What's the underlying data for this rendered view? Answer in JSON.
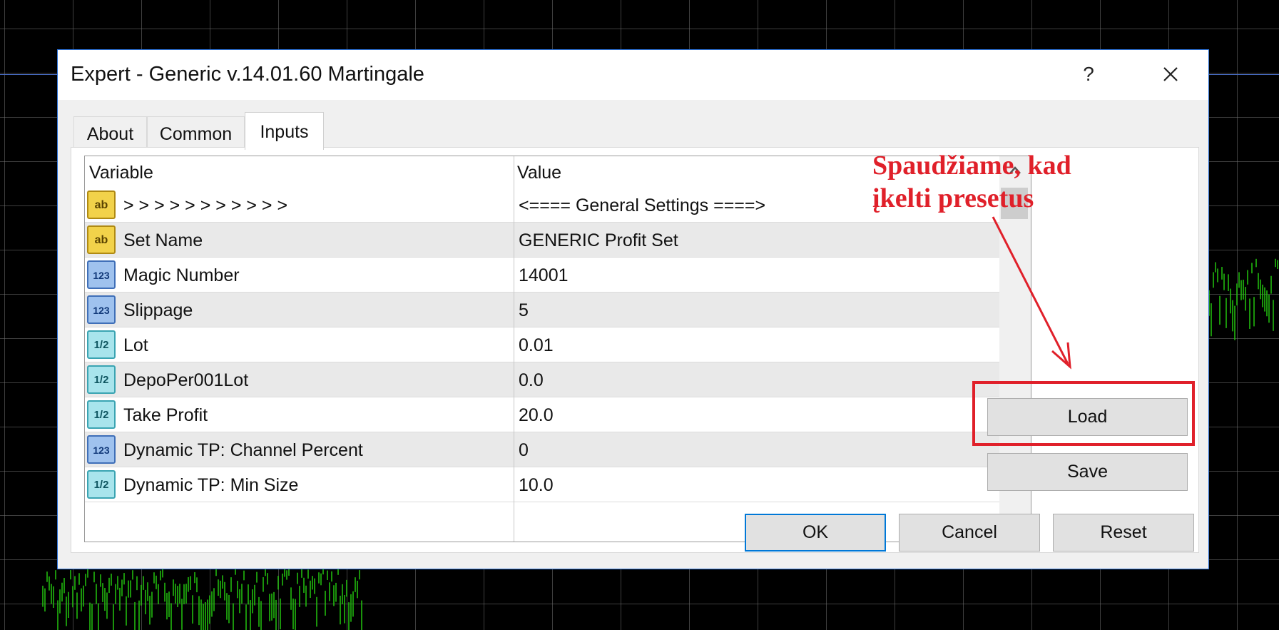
{
  "window": {
    "title": "Expert - Generic v.14.01.60 Martingale",
    "help_label": "?",
    "close_icon": "close-icon"
  },
  "tabs": [
    {
      "label": "About",
      "active": false
    },
    {
      "label": "Common",
      "active": false
    },
    {
      "label": "Inputs",
      "active": true
    }
  ],
  "table": {
    "columns": [
      "Variable",
      "Value"
    ],
    "rows": [
      {
        "icon": "string-icon",
        "type": "ab",
        "name": ">  >  >  >  >  >  >   >   >   >   >",
        "value": "<==== General Settings ====>"
      },
      {
        "icon": "string-icon",
        "type": "ab",
        "name": "Set Name",
        "value": "GENERIC Profit Set"
      },
      {
        "icon": "integer-icon",
        "type": "123",
        "name": "Magic Number",
        "value": "14001"
      },
      {
        "icon": "integer-icon",
        "type": "123",
        "name": "Slippage",
        "value": "5"
      },
      {
        "icon": "double-icon",
        "type": "1/2",
        "name": "Lot",
        "value": "0.01"
      },
      {
        "icon": "double-icon",
        "type": "1/2",
        "name": "DepoPer001Lot",
        "value": "0.0"
      },
      {
        "icon": "double-icon",
        "type": "1/2",
        "name": "Take Profit",
        "value": "20.0"
      },
      {
        "icon": "integer-icon",
        "type": "123",
        "name": "Dynamic TP: Channel Percent",
        "value": "0"
      },
      {
        "icon": "double-icon",
        "type": "1/2",
        "name": "Dynamic TP: Min Size",
        "value": "10.0"
      }
    ]
  },
  "side_buttons": {
    "load": "Load",
    "save": "Save"
  },
  "footer_buttons": {
    "ok": "OK",
    "cancel": "Cancel",
    "reset": "Reset"
  },
  "annotation": {
    "line1": "Spaudžiame, kad",
    "line2": "įkelti presetus",
    "color": "#e0202a"
  },
  "colors": {
    "accent": "#0078d7",
    "chart_bars": "#22c40f",
    "chart_background": "#000000"
  }
}
